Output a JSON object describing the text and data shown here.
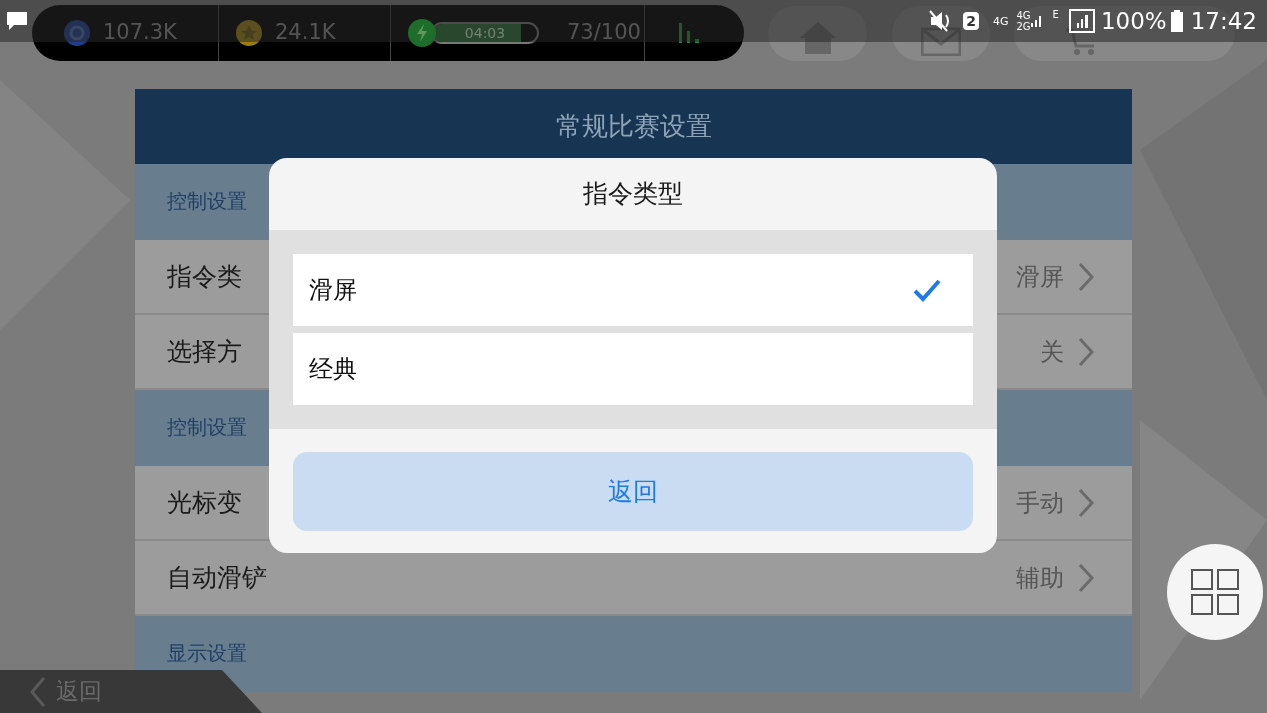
{
  "hud": {
    "gems": "107.3K",
    "coins": "24.1K",
    "energy": {
      "timer": "04:03",
      "level": 0.85,
      "count": "73/100"
    }
  },
  "status_bar": {
    "sim": "2",
    "network_1": "4G",
    "network_2": "4G",
    "network_3": "2G",
    "network_4": "E",
    "battery": "100%",
    "time": "17:42"
  },
  "settings": {
    "title": "常规比赛设置",
    "rows": [
      {
        "kind": "section",
        "label": "控制设置"
      },
      {
        "kind": "option",
        "label": "指令类",
        "value": "滑屏"
      },
      {
        "kind": "option",
        "label": "选择方",
        "value": "关"
      },
      {
        "kind": "section",
        "label": "控制设置"
      },
      {
        "kind": "option",
        "label": "光标变",
        "value": "手动"
      },
      {
        "kind": "option",
        "label": "自动滑铲",
        "value": "辅助"
      },
      {
        "kind": "section",
        "label": "显示设置"
      }
    ]
  },
  "dialog": {
    "title": "指令类型",
    "options": [
      {
        "label": "滑屏",
        "selected": true
      },
      {
        "label": "经典",
        "selected": false
      }
    ],
    "button": "返回"
  },
  "back": "返回"
}
